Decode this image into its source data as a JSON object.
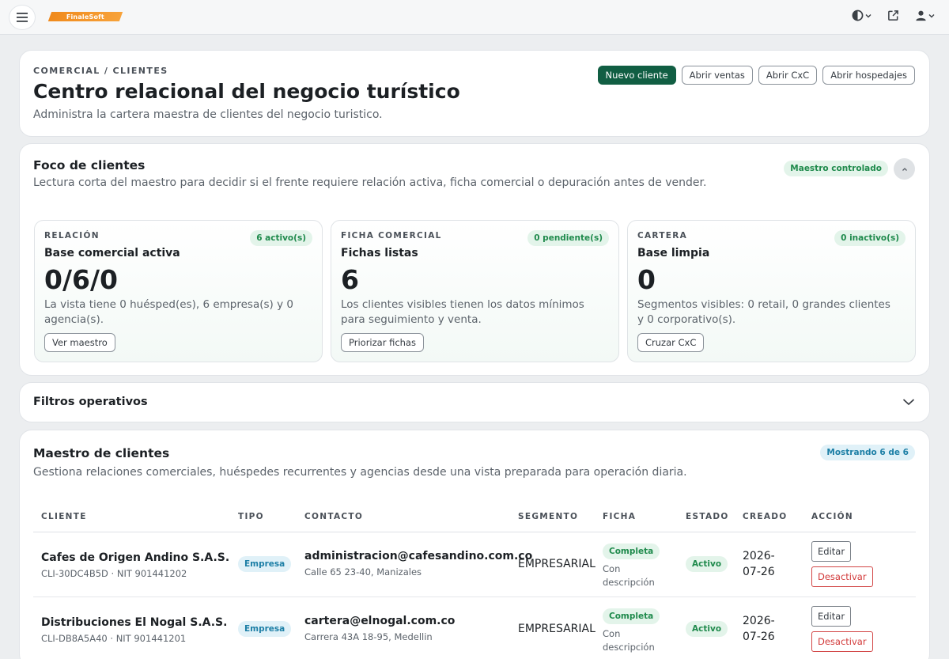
{
  "topbar": {
    "logo_text": "FinaleSoft",
    "icons": [
      "menu-icon",
      "theme-icon",
      "external-link-icon",
      "user-icon"
    ]
  },
  "header": {
    "breadcrumb": "COMERCIAL / CLIENTES",
    "title": "Centro relacional del negocio turístico",
    "subtitle": "Administra la cartera maestra de clientes del negocio turistico.",
    "actions": {
      "new_client": "Nuevo cliente",
      "open_sales": "Abrir ventas",
      "open_cxc": "Abrir CxC",
      "open_stays": "Abrir hospedajes"
    }
  },
  "focus": {
    "title": "Foco de clientes",
    "subtitle": "Lectura corta del maestro para decidir si el frente requiere relación activa, ficha comercial o depuración antes de vender.",
    "badge": "Maestro controlado",
    "cards": [
      {
        "eyebrow": "RELACIÓN",
        "pill": "6 activo(s)",
        "title": "Base comercial activa",
        "value": "0/6/0",
        "description": "La vista tiene 0 huésped(es), 6 empresa(s) y 0 agencia(s).",
        "button": "Ver maestro"
      },
      {
        "eyebrow": "FICHA COMERCIAL",
        "pill": "0 pendiente(s)",
        "title": "Fichas listas",
        "value": "6",
        "description": "Los clientes visibles tienen los datos mínimos para seguimiento y venta.",
        "button": "Priorizar fichas"
      },
      {
        "eyebrow": "CARTERA",
        "pill": "0 inactivo(s)",
        "title": "Base limpia",
        "value": "0",
        "description": "Segmentos visibles: 0 retail, 0 grandes clientes y 0 corporativo(s).",
        "button": "Cruzar CxC"
      }
    ]
  },
  "filters": {
    "title": "Filtros operativos"
  },
  "master": {
    "title": "Maestro de clientes",
    "subtitle": "Gestiona relaciones comerciales, huéspedes recurrentes y agencias desde una vista preparada para operación diaria.",
    "badge": "Mostrando 6 de 6",
    "columns": [
      "CLIENTE",
      "TIPO",
      "CONTACTO",
      "SEGMENTO",
      "FICHA",
      "ESTADO",
      "CREADO",
      "ACCIÓN"
    ],
    "rows": [
      {
        "name": "Cafes de Origen Andino S.A.S.",
        "meta": "CLI-30DC4B5D · NIT 901441202",
        "type": "Empresa",
        "email": "administracion@cafesandino.com.co",
        "address": "Calle 65 23-40, Manizales",
        "segment": "EMPRESARIAL",
        "ficha": "Completa",
        "ficha_note": "Con descripción",
        "status": "Activo",
        "created": "2026-07-26",
        "edit": "Editar",
        "deactivate": "Desactivar"
      },
      {
        "name": "Distribuciones El Nogal S.A.S.",
        "meta": "CLI-DB8A5A40 · NIT 901441201",
        "type": "Empresa",
        "email": "cartera@elnogal.com.co",
        "address": "Carrera 43A 18-95, Medellin",
        "segment": "EMPRESARIAL",
        "ficha": "Completa",
        "ficha_note": "Con descripción",
        "status": "Activo",
        "created": "2026-07-26",
        "edit": "Editar",
        "deactivate": "Desactivar"
      }
    ]
  }
}
